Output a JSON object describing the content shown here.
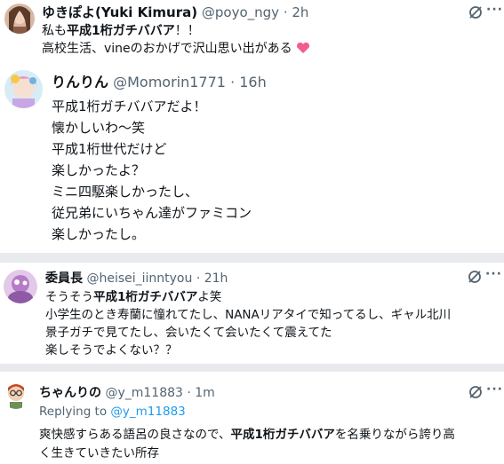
{
  "tweets": [
    {
      "display_name": "ゆきぽよ(Yuki Kimura)",
      "handle": "@poyo_ngy",
      "time": "· 2h",
      "lines": [
        {
          "prefix": "私も",
          "highlight": "平成1桁ガチババア",
          "suffix": "！！"
        },
        {
          "prefix": "高校生活、vineのおかげで沢山思い出がある",
          "highlight": "",
          "suffix": ""
        }
      ],
      "emoji": "heart"
    },
    {
      "display_name": "りんりん",
      "handle": "@Momorin1771",
      "time": "· 16h",
      "lines": [
        "平成1桁ガチババアだよ！",
        "懐かしいわ〜笑",
        "平成1桁世代だけど",
        "楽しかったよ？",
        "ミニ四駆楽しかったし、",
        "従兄弟にいちゃん達がファミコン",
        "楽しかったし。"
      ]
    },
    {
      "display_name": "委員長",
      "handle": "@heisei_iinntyou",
      "time": "· 21h",
      "lines": [
        {
          "prefix": "そうそう",
          "highlight": "平成1桁ガチババア",
          "suffix": "よ笑"
        },
        {
          "prefix": "小学生のとき寿蘭に憧れてたし、NANAリアタイで知ってるし、ギャル北川",
          "highlight": "",
          "suffix": ""
        },
        {
          "prefix": "景子ガチで見てたし、会いたくて会いたくて震えてた",
          "highlight": "",
          "suffix": ""
        },
        {
          "prefix": "楽しそうでよくない？？",
          "highlight": "",
          "suffix": ""
        }
      ]
    },
    {
      "display_name": "ちゃんりの",
      "handle": "@y_m11883",
      "time": "· 1m",
      "replying_prefix": "Replying to",
      "replying_handle": "@y_m11883",
      "lines": [
        {
          "prefix": "爽快感すらある語呂の良さなので、",
          "highlight": "平成1桁ガチババア",
          "suffix": "を名乗りながら誇り高"
        },
        {
          "prefix": "く生きていきたい所存",
          "highlight": "",
          "suffix": ""
        }
      ]
    }
  ],
  "icons": {
    "grok": "grok-icon",
    "more": "more-icon",
    "heart": "heart-emoji"
  },
  "more_glyph": "···"
}
